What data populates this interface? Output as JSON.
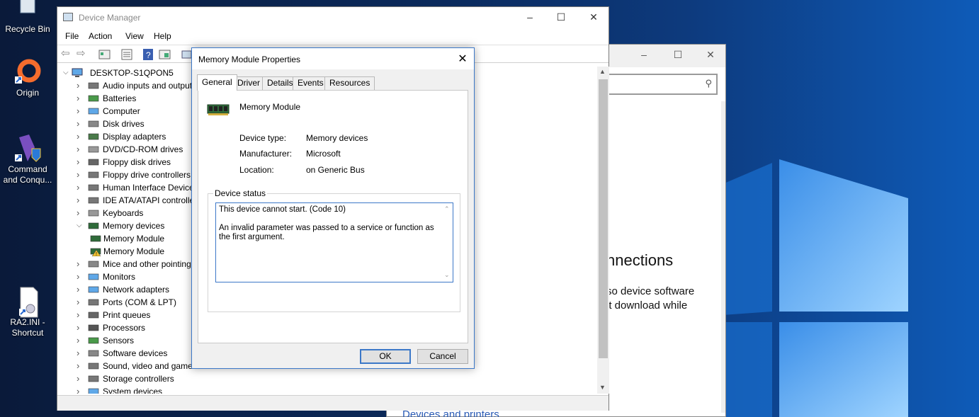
{
  "desktop": {
    "icons": [
      {
        "label": "Recycle Bin"
      },
      {
        "label": "Origin"
      },
      {
        "label": "Command and Conqu..."
      },
      {
        "label": "RA2.INI - Shortcut"
      }
    ]
  },
  "background_window": {
    "heading": "nnections",
    "text_line1": "so device software",
    "text_line2": "’t download while",
    "link": "Devices and printers"
  },
  "device_manager": {
    "title": "Device Manager",
    "menu": [
      "File",
      "Action",
      "View",
      "Help"
    ],
    "root": "DESKTOP-S1QPON5",
    "tree": [
      {
        "label": "Audio inputs and outputs",
        "icon": "speaker-icon"
      },
      {
        "label": "Batteries",
        "icon": "battery-icon"
      },
      {
        "label": "Computer",
        "icon": "monitor-icon"
      },
      {
        "label": "Disk drives",
        "icon": "disk-icon"
      },
      {
        "label": "Display adapters",
        "icon": "display-adapter-icon"
      },
      {
        "label": "DVD/CD-ROM drives",
        "icon": "dvd-icon"
      },
      {
        "label": "Floppy disk drives",
        "icon": "floppy-icon"
      },
      {
        "label": "Floppy drive controllers",
        "icon": "controller-icon"
      },
      {
        "label": "Human Interface Devices",
        "icon": "hid-icon"
      },
      {
        "label": "IDE ATA/ATAPI controllers",
        "icon": "ide-icon"
      },
      {
        "label": "Keyboards",
        "icon": "keyboard-icon"
      },
      {
        "label": "Memory devices",
        "icon": "memory-icon",
        "expanded": true
      },
      {
        "label": "Memory Module",
        "icon": "memory-icon",
        "child": true
      },
      {
        "label": "Memory Module",
        "icon": "memory-warning-icon",
        "child": true
      },
      {
        "label": "Mice and other pointing devices",
        "icon": "mouse-icon"
      },
      {
        "label": "Monitors",
        "icon": "monitor-icon"
      },
      {
        "label": "Network adapters",
        "icon": "network-icon"
      },
      {
        "label": "Ports (COM & LPT)",
        "icon": "port-icon"
      },
      {
        "label": "Print queues",
        "icon": "printer-icon"
      },
      {
        "label": "Processors",
        "icon": "cpu-icon"
      },
      {
        "label": "Sensors",
        "icon": "sensor-icon"
      },
      {
        "label": "Software devices",
        "icon": "software-icon"
      },
      {
        "label": "Sound, video and game controllers",
        "icon": "speaker-icon"
      },
      {
        "label": "Storage controllers",
        "icon": "storage-icon"
      },
      {
        "label": "System devices",
        "icon": "system-icon"
      }
    ]
  },
  "dialog": {
    "title": "Memory Module Properties",
    "tabs": [
      "General",
      "Driver",
      "Details",
      "Events",
      "Resources"
    ],
    "device_name": "Memory Module",
    "device_type_label": "Device type:",
    "device_type": "Memory devices",
    "manufacturer_label": "Manufacturer:",
    "manufacturer": "Microsoft",
    "location_label": "Location:",
    "location": "on Generic Bus",
    "status_group": "Device status",
    "status_line1": "This device cannot start. (Code 10)",
    "status_line2": "An invalid parameter was passed to a service or function as the first argument.",
    "ok": "OK",
    "cancel": "Cancel"
  }
}
